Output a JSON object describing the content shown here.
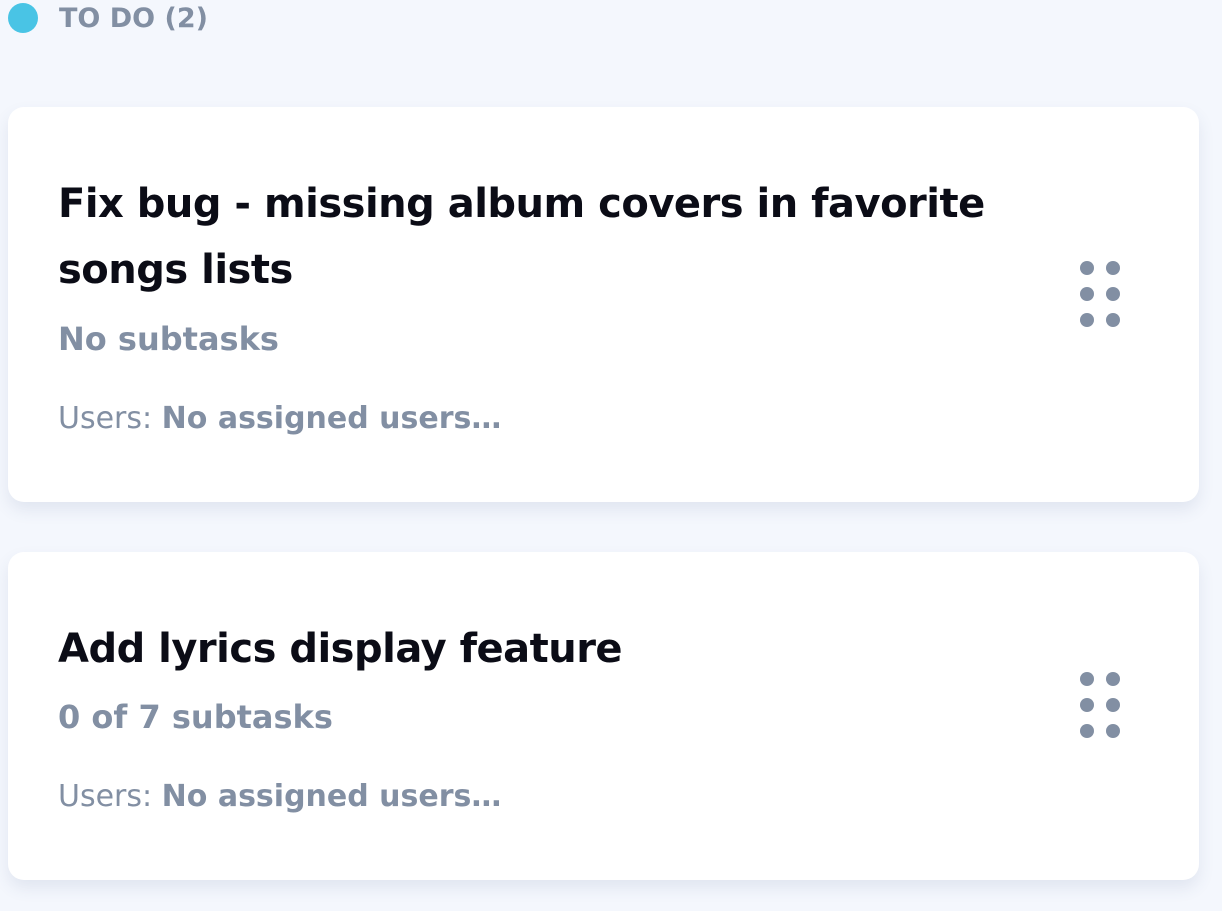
{
  "column": {
    "title": "TO DO (2)",
    "dot_color": "#49c4e5"
  },
  "tasks": [
    {
      "title": "Fix bug - missing album covers in favorite songs lists",
      "subtasks": "No subtasks",
      "users_label": "Users:",
      "users_value": "No assigned users…"
    },
    {
      "title": "Add lyrics display feature",
      "subtasks": "0 of 7 subtasks",
      "users_label": "Users:",
      "users_value": "No assigned users…"
    }
  ],
  "icons": {
    "status": "status-dot-icon",
    "drag": "drag-handle-icon"
  },
  "colors": {
    "background": "#f4f7fd",
    "card": "#ffffff",
    "title_text": "#0b0c16",
    "muted_text": "#828fa3"
  }
}
